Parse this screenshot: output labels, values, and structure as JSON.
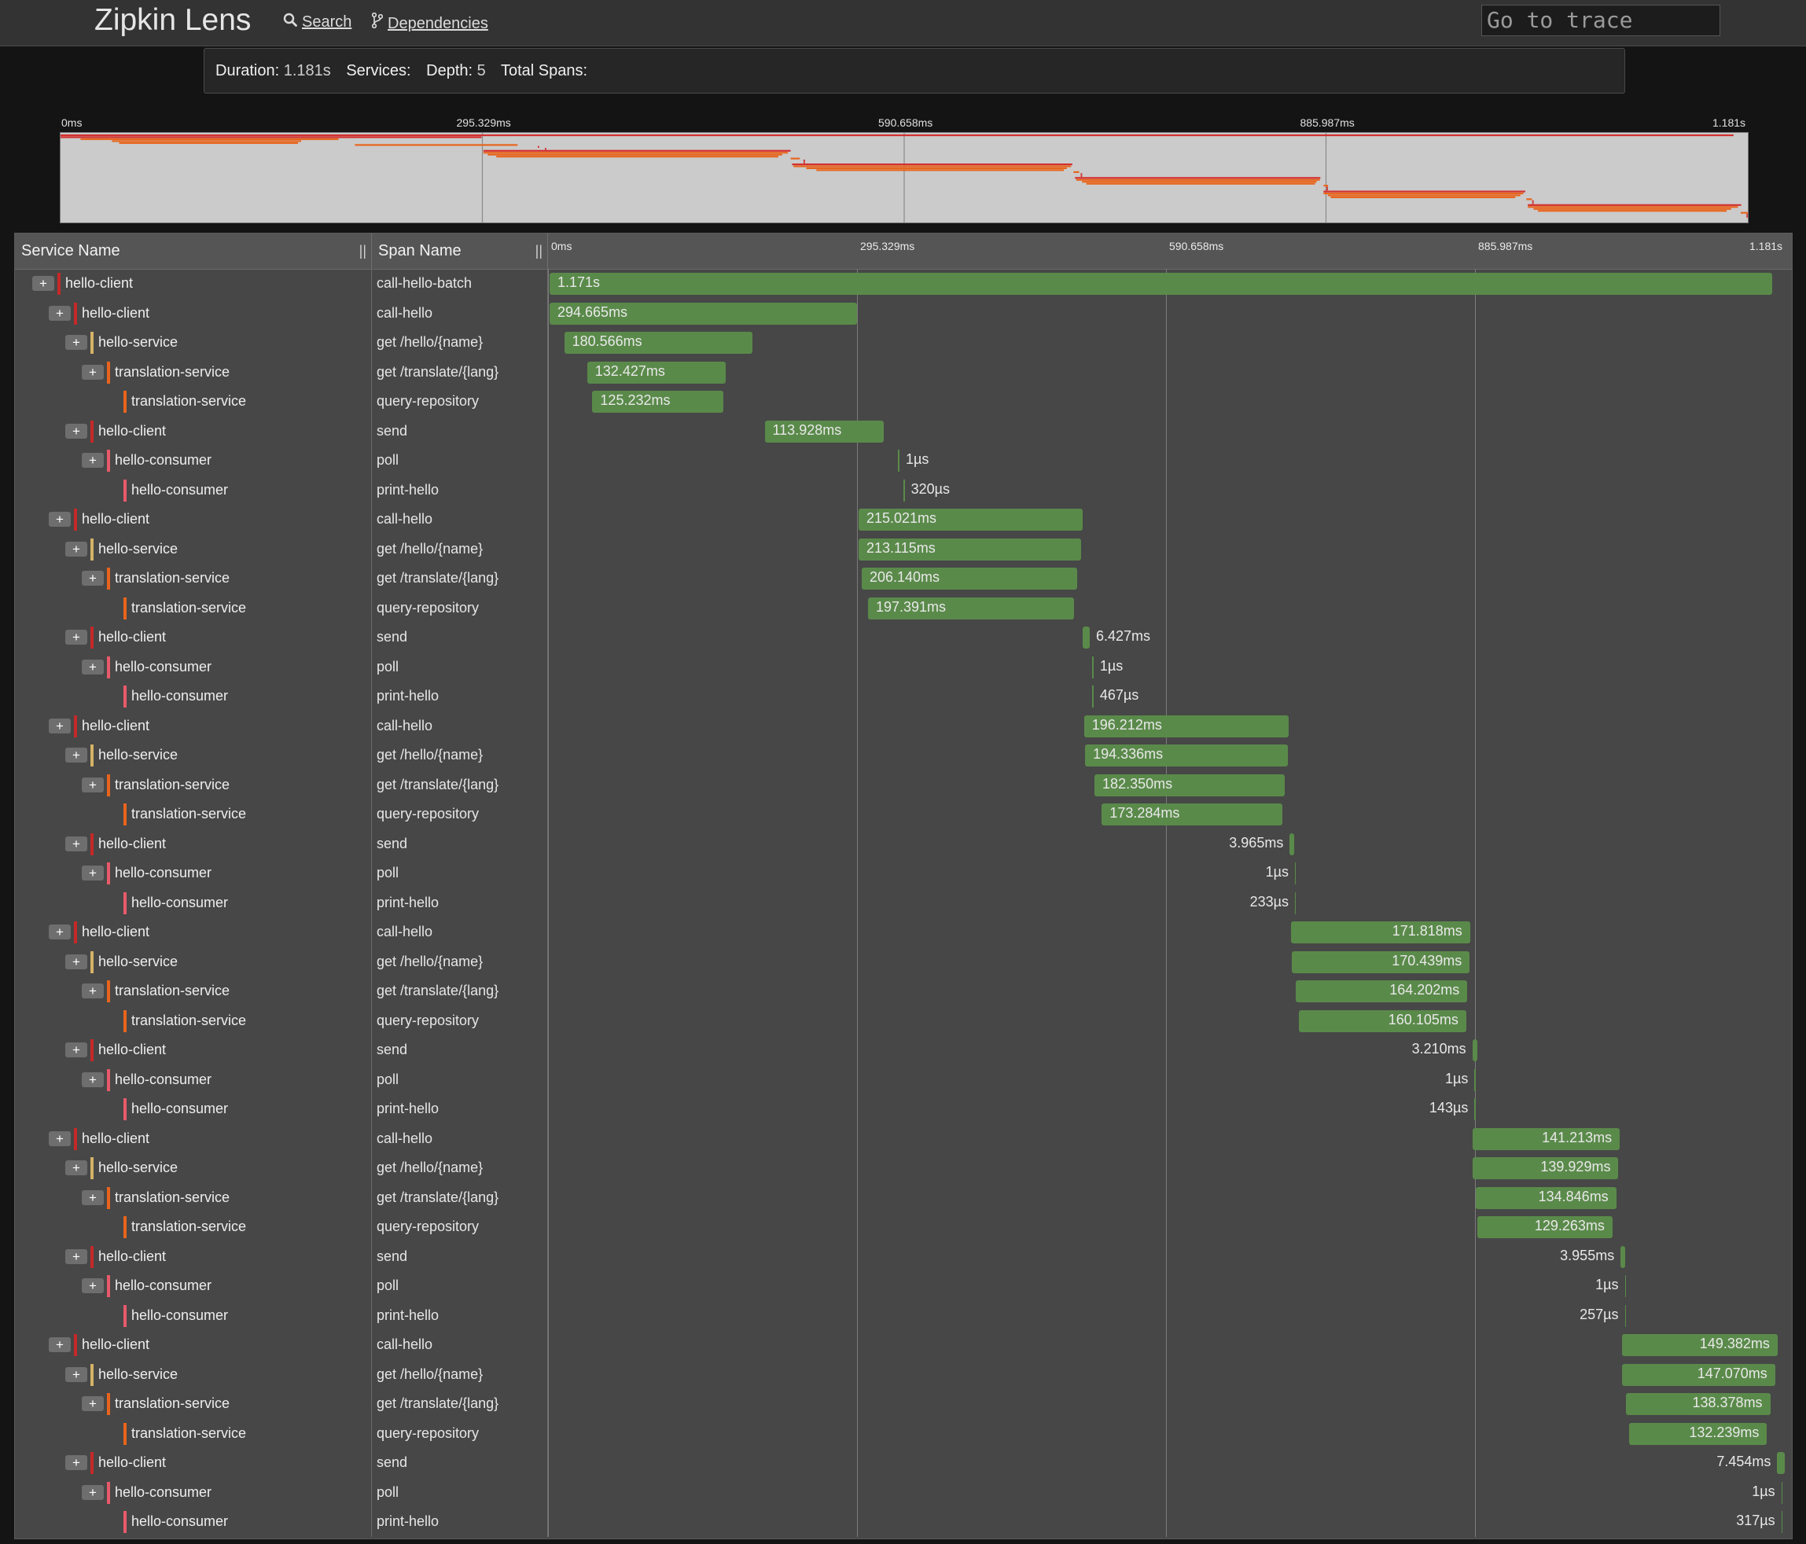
{
  "app": {
    "brand": "Zipkin Lens",
    "nav": {
      "search_label": "Search",
      "dependencies_label": "Dependencies"
    },
    "goto_placeholder": "Go to trace"
  },
  "summary": {
    "duration_label": "Duration:",
    "duration_value": "1.181s",
    "services_label": "Services:",
    "services_value": "",
    "depth_label": "Depth:",
    "depth_value": "5",
    "total_spans_label": "Total Spans:",
    "total_spans_value": ""
  },
  "timeline": {
    "total_ms": 1181,
    "ticks": [
      "0ms",
      "295.329ms",
      "590.658ms",
      "885.987ms",
      "1.181s"
    ]
  },
  "columns": {
    "service": "Service Name",
    "span": "Span Name",
    "resize_glyph": "||"
  },
  "colors": {
    "hello-client": "#c62828",
    "hello-service": "#d4b266",
    "translation-service": "#e8641c",
    "hello-consumer": "#e85a6a",
    "bar": "#5a8a4a",
    "minimap_bar": "#e8641c"
  },
  "spans": [
    {
      "depth": 0,
      "toggle": true,
      "service": "hello-client",
      "name": "call-hello-batch",
      "start": 0,
      "dur": 1171,
      "label": "1.171s"
    },
    {
      "depth": 1,
      "toggle": true,
      "service": "hello-client",
      "name": "call-hello",
      "start": 0,
      "dur": 294.665,
      "label": "294.665ms"
    },
    {
      "depth": 2,
      "toggle": true,
      "service": "hello-service",
      "name": "get /hello/{name}",
      "start": 14,
      "dur": 180.566,
      "label": "180.566ms"
    },
    {
      "depth": 3,
      "toggle": true,
      "service": "translation-service",
      "name": "get /translate/{lang}",
      "start": 36,
      "dur": 132.427,
      "label": "132.427ms"
    },
    {
      "depth": 4,
      "toggle": false,
      "service": "translation-service",
      "name": "query-repository",
      "start": 41,
      "dur": 125.232,
      "label": "125.232ms"
    },
    {
      "depth": 2,
      "toggle": true,
      "service": "hello-client",
      "name": "send",
      "start": 206,
      "dur": 113.928,
      "label": "113.928ms"
    },
    {
      "depth": 3,
      "toggle": true,
      "service": "hello-consumer",
      "name": "poll",
      "start": 334,
      "dur": 0.001,
      "label": "1µs"
    },
    {
      "depth": 4,
      "toggle": false,
      "service": "hello-consumer",
      "name": "print-hello",
      "start": 339,
      "dur": 0.32,
      "label": "320µs"
    },
    {
      "depth": 1,
      "toggle": true,
      "service": "hello-client",
      "name": "call-hello",
      "start": 296,
      "dur": 215.021,
      "label": "215.021ms"
    },
    {
      "depth": 2,
      "toggle": true,
      "service": "hello-service",
      "name": "get /hello/{name}",
      "start": 296,
      "dur": 213.115,
      "label": "213.115ms"
    },
    {
      "depth": 3,
      "toggle": true,
      "service": "translation-service",
      "name": "get /translate/{lang}",
      "start": 299,
      "dur": 206.14,
      "label": "206.140ms"
    },
    {
      "depth": 4,
      "toggle": false,
      "service": "translation-service",
      "name": "query-repository",
      "start": 305,
      "dur": 197.391,
      "label": "197.391ms"
    },
    {
      "depth": 2,
      "toggle": true,
      "service": "hello-client",
      "name": "send",
      "start": 511,
      "dur": 6.427,
      "label": "6.427ms"
    },
    {
      "depth": 3,
      "toggle": true,
      "service": "hello-consumer",
      "name": "poll",
      "start": 520,
      "dur": 0.001,
      "label": "1µs"
    },
    {
      "depth": 4,
      "toggle": false,
      "service": "hello-consumer",
      "name": "print-hello",
      "start": 520,
      "dur": 0.467,
      "label": "467µs"
    },
    {
      "depth": 1,
      "toggle": true,
      "service": "hello-client",
      "name": "call-hello",
      "start": 512,
      "dur": 196.212,
      "label": "196.212ms"
    },
    {
      "depth": 2,
      "toggle": true,
      "service": "hello-service",
      "name": "get /hello/{name}",
      "start": 513,
      "dur": 194.336,
      "label": "194.336ms"
    },
    {
      "depth": 3,
      "toggle": true,
      "service": "translation-service",
      "name": "get /translate/{lang}",
      "start": 522,
      "dur": 182.35,
      "label": "182.350ms"
    },
    {
      "depth": 4,
      "toggle": false,
      "service": "translation-service",
      "name": "query-repository",
      "start": 529,
      "dur": 173.284,
      "label": "173.284ms"
    },
    {
      "depth": 2,
      "toggle": true,
      "service": "hello-client",
      "name": "send",
      "start": 709,
      "dur": 3.965,
      "label": "3.965ms"
    },
    {
      "depth": 3,
      "toggle": true,
      "service": "hello-consumer",
      "name": "poll",
      "start": 714,
      "dur": 0.001,
      "label": "1µs"
    },
    {
      "depth": 4,
      "toggle": false,
      "service": "hello-consumer",
      "name": "print-hello",
      "start": 714,
      "dur": 0.233,
      "label": "233µs"
    },
    {
      "depth": 1,
      "toggle": true,
      "service": "hello-client",
      "name": "call-hello",
      "start": 710,
      "dur": 171.818,
      "label": "171.818ms"
    },
    {
      "depth": 2,
      "toggle": true,
      "service": "hello-service",
      "name": "get /hello/{name}",
      "start": 711,
      "dur": 170.439,
      "label": "170.439ms"
    },
    {
      "depth": 3,
      "toggle": true,
      "service": "translation-service",
      "name": "get /translate/{lang}",
      "start": 715,
      "dur": 164.202,
      "label": "164.202ms"
    },
    {
      "depth": 4,
      "toggle": false,
      "service": "translation-service",
      "name": "query-repository",
      "start": 718,
      "dur": 160.105,
      "label": "160.105ms"
    },
    {
      "depth": 2,
      "toggle": true,
      "service": "hello-client",
      "name": "send",
      "start": 884,
      "dur": 3.21,
      "label": "3.210ms"
    },
    {
      "depth": 3,
      "toggle": true,
      "service": "hello-consumer",
      "name": "poll",
      "start": 886,
      "dur": 0.001,
      "label": "1µs"
    },
    {
      "depth": 4,
      "toggle": false,
      "service": "hello-consumer",
      "name": "print-hello",
      "start": 886,
      "dur": 0.143,
      "label": "143µs"
    },
    {
      "depth": 1,
      "toggle": true,
      "service": "hello-client",
      "name": "call-hello",
      "start": 884,
      "dur": 141.213,
      "label": "141.213ms"
    },
    {
      "depth": 2,
      "toggle": true,
      "service": "hello-service",
      "name": "get /hello/{name}",
      "start": 884,
      "dur": 139.929,
      "label": "139.929ms"
    },
    {
      "depth": 3,
      "toggle": true,
      "service": "translation-service",
      "name": "get /translate/{lang}",
      "start": 887,
      "dur": 134.846,
      "label": "134.846ms"
    },
    {
      "depth": 4,
      "toggle": false,
      "service": "translation-service",
      "name": "query-repository",
      "start": 889,
      "dur": 129.263,
      "label": "129.263ms"
    },
    {
      "depth": 2,
      "toggle": true,
      "service": "hello-client",
      "name": "send",
      "start": 1026,
      "dur": 3.955,
      "label": "3.955ms"
    },
    {
      "depth": 3,
      "toggle": true,
      "service": "hello-consumer",
      "name": "poll",
      "start": 1030,
      "dur": 0.001,
      "label": "1µs"
    },
    {
      "depth": 4,
      "toggle": false,
      "service": "hello-consumer",
      "name": "print-hello",
      "start": 1030,
      "dur": 0.257,
      "label": "257µs"
    },
    {
      "depth": 1,
      "toggle": true,
      "service": "hello-client",
      "name": "call-hello",
      "start": 1027,
      "dur": 149.382,
      "label": "149.382ms"
    },
    {
      "depth": 2,
      "toggle": true,
      "service": "hello-service",
      "name": "get /hello/{name}",
      "start": 1027,
      "dur": 147.07,
      "label": "147.070ms"
    },
    {
      "depth": 3,
      "toggle": true,
      "service": "translation-service",
      "name": "get /translate/{lang}",
      "start": 1031,
      "dur": 138.378,
      "label": "138.378ms"
    },
    {
      "depth": 4,
      "toggle": false,
      "service": "translation-service",
      "name": "query-repository",
      "start": 1034,
      "dur": 132.239,
      "label": "132.239ms"
    },
    {
      "depth": 2,
      "toggle": true,
      "service": "hello-client",
      "name": "send",
      "start": 1176,
      "dur": 7.454,
      "label": "7.454ms"
    },
    {
      "depth": 3,
      "toggle": true,
      "service": "hello-consumer",
      "name": "poll",
      "start": 1180,
      "dur": 0.001,
      "label": "1µs"
    },
    {
      "depth": 4,
      "toggle": false,
      "service": "hello-consumer",
      "name": "print-hello",
      "start": 1180,
      "dur": 0.317,
      "label": "317µs"
    }
  ]
}
